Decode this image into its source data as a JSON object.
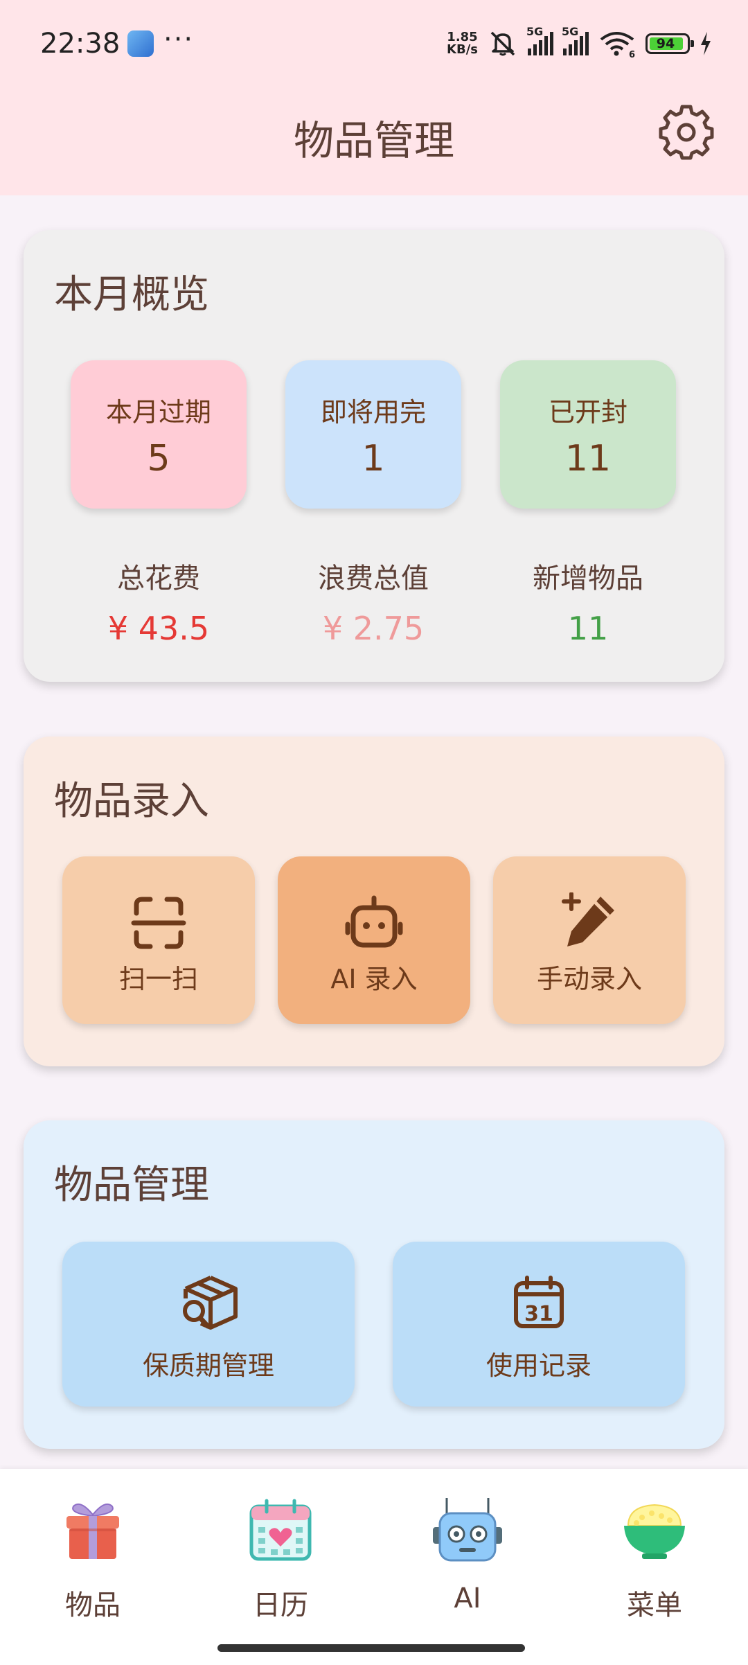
{
  "status_bar": {
    "time": "22:38",
    "notification_dots": "···",
    "net_speed_value": "1.85",
    "net_speed_unit": "KB/s",
    "signal_1": "5G",
    "signal_2": "5G",
    "wifi_badge": "6",
    "battery": "94"
  },
  "app_bar": {
    "title": "物品管理",
    "settings_icon": "gear-icon"
  },
  "overview": {
    "title": "本月概览",
    "tiles": [
      {
        "label": "本月过期",
        "value": "5",
        "color": "#FFCCD6"
      },
      {
        "label": "即将用完",
        "value": "1",
        "color": "#CCE3FB"
      },
      {
        "label": "已开封",
        "value": "11",
        "color": "#CBE6CB"
      }
    ],
    "summary": [
      {
        "label": "总花费",
        "value": "¥ 43.5",
        "color": "#E53935"
      },
      {
        "label": "浪费总值",
        "value": "¥ 2.75",
        "color": "#EF9A9A"
      },
      {
        "label": "新增物品",
        "value": "11",
        "color": "#43A047"
      }
    ]
  },
  "entry": {
    "title": "物品录入",
    "buttons": [
      {
        "label": "扫一扫",
        "icon": "scan-icon"
      },
      {
        "label": "AI 录入",
        "icon": "robot-icon"
      },
      {
        "label": "手动录入",
        "icon": "pencil-plus-icon"
      }
    ]
  },
  "manage": {
    "title": "物品管理",
    "buttons": [
      {
        "label": "保质期管理",
        "icon": "box-search-icon"
      },
      {
        "label": "使用记录",
        "icon": "calendar-31-icon",
        "calendar_day": "31"
      }
    ]
  },
  "bottom_nav": [
    {
      "label": "物品",
      "icon": "gift-icon"
    },
    {
      "label": "日历",
      "icon": "calendar-heart-icon"
    },
    {
      "label": "AI",
      "icon": "robot-face-icon"
    },
    {
      "label": "菜单",
      "icon": "rice-bowl-icon"
    }
  ]
}
